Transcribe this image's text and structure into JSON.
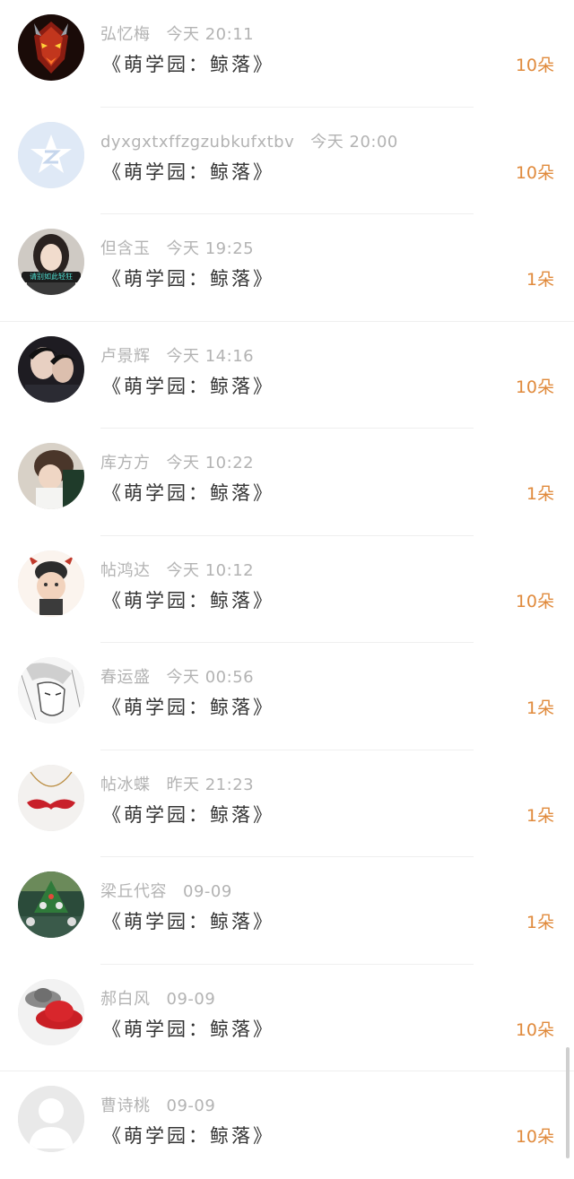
{
  "rows": [
    {
      "name": "弘忆梅",
      "time": "今天 20:11",
      "title": "《萌学园：鲸落》",
      "count": "10朵"
    },
    {
      "name": "dyxgxtxffzgzubkufxtbv",
      "time": "今天 20:00",
      "title": "《萌学园：鲸落》",
      "count": "10朵"
    },
    {
      "name": "但含玉",
      "time": "今天 19:25",
      "title": "《萌学园：鲸落》",
      "count": "1朵"
    },
    {
      "name": "卢景辉",
      "time": "今天 14:16",
      "title": "《萌学园：鲸落》",
      "count": "10朵"
    },
    {
      "name": "库方方",
      "time": "今天 10:22",
      "title": "《萌学园：鲸落》",
      "count": "1朵"
    },
    {
      "name": "帖鸿达",
      "time": "今天 10:12",
      "title": "《萌学园：鲸落》",
      "count": "10朵"
    },
    {
      "name": "春运盛",
      "time": "今天 00:56",
      "title": "《萌学园：鲸落》",
      "count": "1朵"
    },
    {
      "name": "帖冰蝶",
      "time": "昨天 21:23",
      "title": "《萌学园：鲸落》",
      "count": "1朵"
    },
    {
      "name": "梁丘代容",
      "time": "09-09",
      "title": "《萌学园：鲸落》",
      "count": "1朵"
    },
    {
      "name": "郝白风",
      "time": "09-09",
      "title": "《萌学园：鲸落》",
      "count": "10朵"
    },
    {
      "name": "曹诗桃",
      "time": "09-09",
      "title": "《萌学园：鲸落》",
      "count": "10朵"
    }
  ],
  "avatar_badge_text": "请别如此轻狂",
  "colors": {
    "count": "#e08a3c",
    "meta": "#b3b3b3",
    "title": "#333333",
    "divider": "#efefef"
  },
  "icons": [
    "demon-mask-avatar",
    "qzone-star-avatar",
    "girl-photo-avatar",
    "two-boys-avatar",
    "girl-face-avatar",
    "baby-sticker-avatar",
    "manga-sketch-avatar",
    "red-mustache-avatar",
    "christmas-tree-avatar",
    "red-hat-avatar",
    "default-user-avatar"
  ]
}
